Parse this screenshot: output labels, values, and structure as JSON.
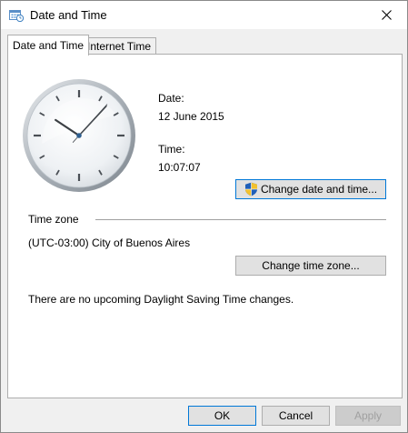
{
  "window": {
    "title": "Date and Time",
    "close_glyph": "✕"
  },
  "tabs": [
    {
      "label": "Date and Time",
      "active": true
    },
    {
      "label": "Internet Time",
      "active": false
    }
  ],
  "date": {
    "label": "Date:",
    "value": "12 June 2015"
  },
  "time": {
    "label": "Time:",
    "value": "10:07:07"
  },
  "clock": {
    "hours": 10,
    "minutes": 7,
    "seconds": 7
  },
  "buttons": {
    "change_date_time": "Change date and time...",
    "change_time_zone": "Change time zone...",
    "ok": "OK",
    "cancel": "Cancel",
    "apply": "Apply"
  },
  "timezone": {
    "heading": "Time zone",
    "value": "(UTC-03:00) City of Buenos Aires",
    "dst_note": "There are no upcoming Daylight Saving Time changes."
  },
  "icons": {
    "app": "calendar-clock-icon",
    "shield": "uac-shield-icon",
    "close": "close-icon"
  },
  "colors": {
    "focus_border": "#0078d7",
    "button_bg": "#e1e1e1",
    "window_bg": "#f0f0f0"
  }
}
